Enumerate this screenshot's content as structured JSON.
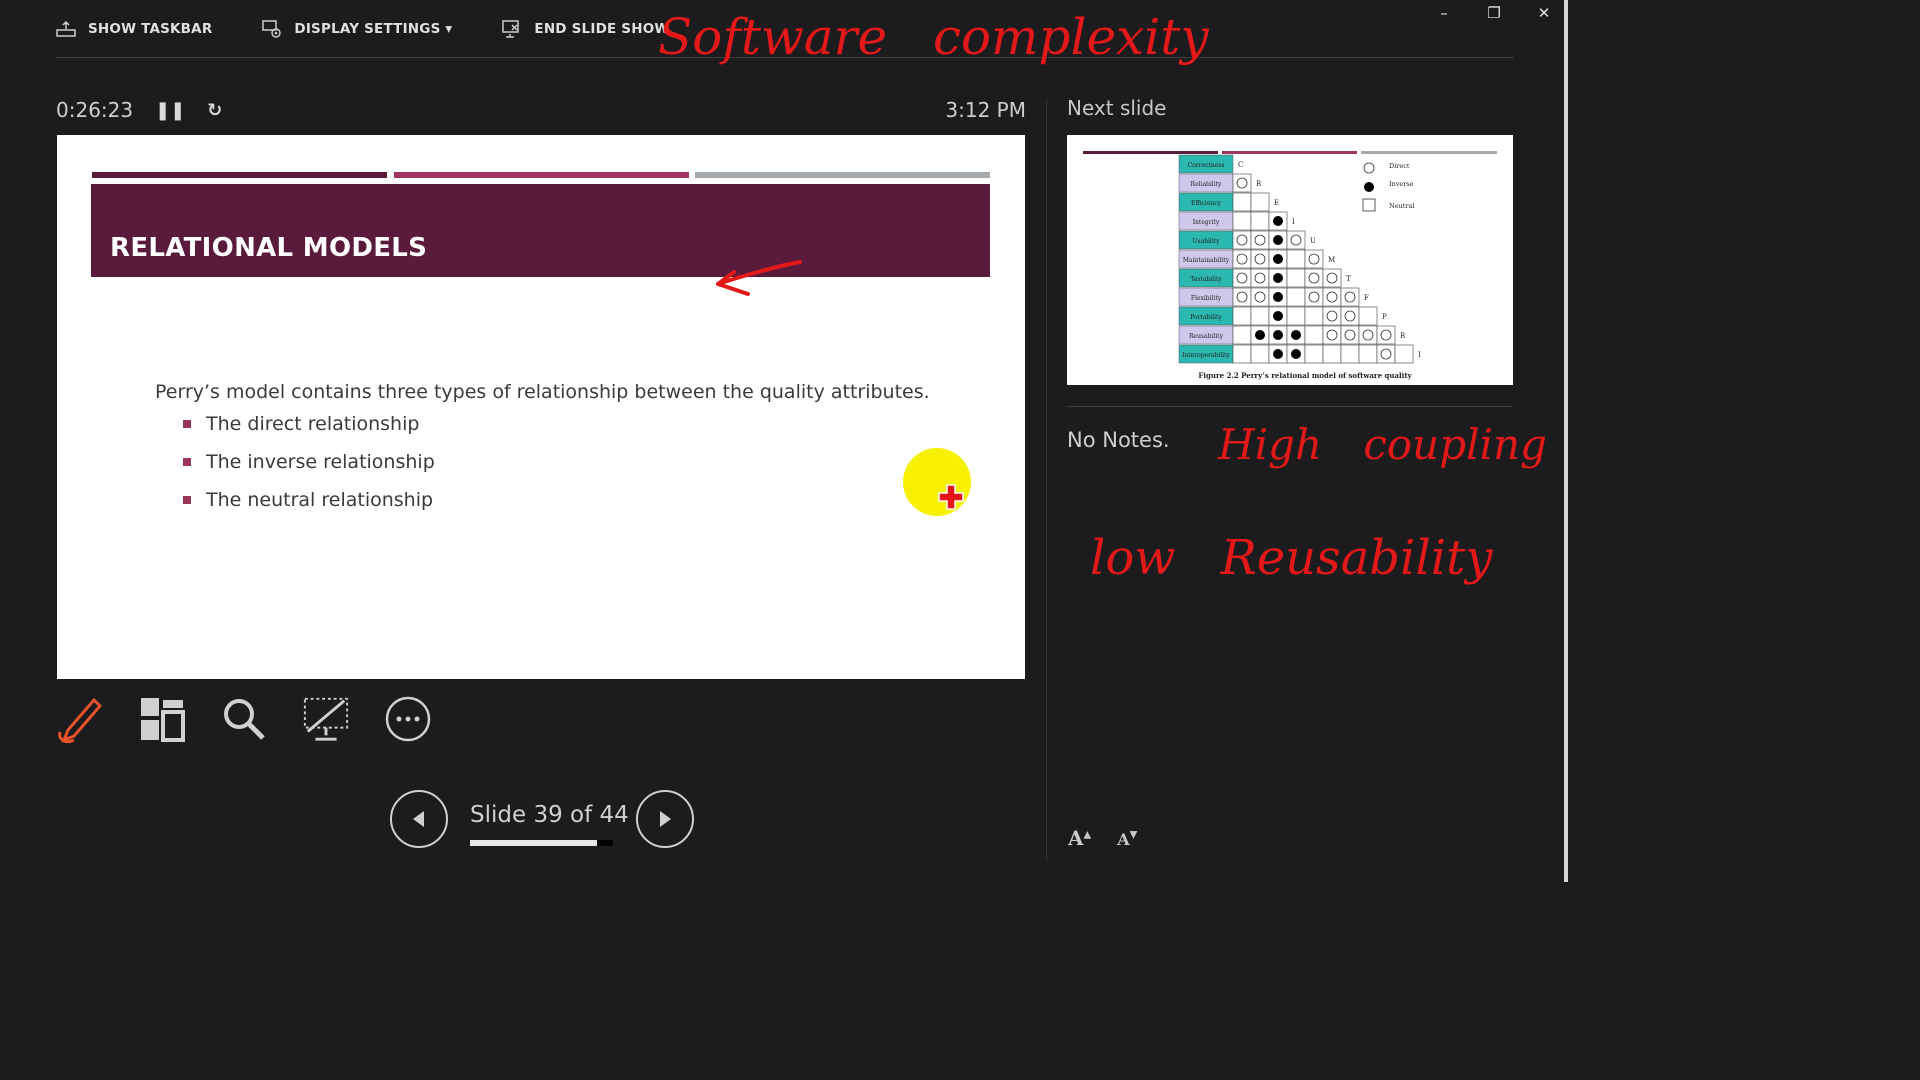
{
  "toolbar": {
    "show_taskbar": "SHOW TASKBAR",
    "display_settings": "DISPLAY SETTINGS ▾",
    "end_slide_show": "END SLIDE SHOW"
  },
  "window_controls": {
    "minimize": "–",
    "restore": "❐",
    "close": "✕"
  },
  "timer": {
    "elapsed": "0:26:23",
    "clock": "3:12 PM"
  },
  "current_slide": {
    "title": "RELATIONAL MODELS",
    "intro": "Perry’s model contains three types of relationship between the quality attributes.",
    "bullets": [
      "The direct relationship",
      "The inverse relationship",
      "The neutral relationship"
    ]
  },
  "navigation": {
    "counter": "Slide 39 of 44",
    "progress": 0.886
  },
  "next_slide": {
    "label": "Next slide",
    "caption": "Figure 2.2 Perry’s relational model of software quality",
    "attributes": [
      "Correctness",
      "Reliability",
      "Efficiency",
      "Integrity",
      "Usability",
      "Maintainability",
      "Testability",
      "Flexibility",
      "Portability",
      "Reusability",
      "Interoperability"
    ],
    "diagonal_letters": [
      "C",
      "R",
      "E",
      "I",
      "U",
      "M",
      "T",
      "F",
      "P",
      "R",
      "I"
    ],
    "legend": [
      "Direct",
      "Inverse",
      "Neutral"
    ]
  },
  "notes": {
    "text": "No Notes."
  },
  "font_controls": {
    "increase": "A",
    "decrease": "A"
  },
  "ink_annotations": {
    "top": "Software complexity",
    "right_1": "High coupling",
    "right_2": "low Reusability"
  },
  "colors": {
    "banner": "#5a1a3b",
    "bar_dark": "#5b1b3c",
    "bar_mid": "#a23461",
    "bar_grey": "#a6abb0",
    "ink": "#e31919",
    "pen_tool": "#e8532b"
  }
}
